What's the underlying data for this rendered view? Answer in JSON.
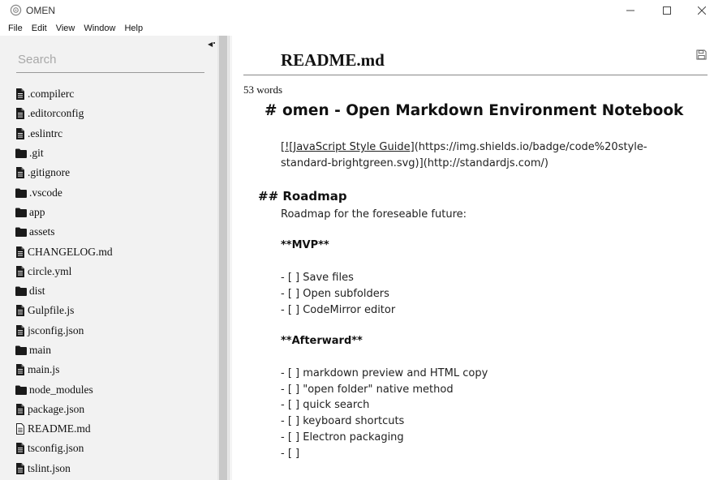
{
  "window": {
    "title": "OMEN"
  },
  "menu": [
    "File",
    "Edit",
    "View",
    "Window",
    "Help"
  ],
  "sidebar": {
    "search_placeholder": "Search",
    "files": [
      {
        "name": ".compilerc",
        "type": "file"
      },
      {
        "name": ".editorconfig",
        "type": "file"
      },
      {
        "name": ".eslintrc",
        "type": "file"
      },
      {
        "name": ".git",
        "type": "folder"
      },
      {
        "name": ".gitignore",
        "type": "file"
      },
      {
        "name": ".vscode",
        "type": "folder"
      },
      {
        "name": "app",
        "type": "folder"
      },
      {
        "name": "assets",
        "type": "folder"
      },
      {
        "name": "CHANGELOG.md",
        "type": "file"
      },
      {
        "name": "circle.yml",
        "type": "file"
      },
      {
        "name": "dist",
        "type": "folder"
      },
      {
        "name": "Gulpfile.js",
        "type": "file"
      },
      {
        "name": "jsconfig.json",
        "type": "file"
      },
      {
        "name": "main",
        "type": "folder"
      },
      {
        "name": "main.js",
        "type": "file"
      },
      {
        "name": "node_modules",
        "type": "folder"
      },
      {
        "name": "package.json",
        "type": "file"
      },
      {
        "name": "README.md",
        "type": "text-file"
      },
      {
        "name": "tsconfig.json",
        "type": "file"
      },
      {
        "name": "tslint.json",
        "type": "file"
      }
    ]
  },
  "editor": {
    "title": "README.md",
    "word_count": "53 words",
    "heading1": "# omen - Open Markdown Environment Notebook",
    "badge_line1_link": "[![JavaScript Style Guide]",
    "badge_line1_rest": "(https://img.shields.io/badge/code%20style-",
    "badge_line2_rest": "standard-brightgreen.svg)",
    "badge_line2_link": "]",
    "badge_line2_tail": "(http://standardjs.com/)",
    "heading2": "## Roadmap",
    "roadmap_intro": "Roadmap for the foreseable future:",
    "mvp_label": "**MVP**",
    "mvp_items": [
      "- [ ] Save files",
      "- [ ] Open subfolders",
      "- [ ] CodeMirror editor"
    ],
    "afterward_label": "**Afterward**",
    "afterward_items": [
      "- [ ] markdown preview and HTML copy",
      "- [ ] \"open folder\" native method",
      "- [ ] quick search",
      "- [ ] keyboard shortcuts",
      "- [ ] Electron packaging",
      "- [ ]"
    ]
  }
}
